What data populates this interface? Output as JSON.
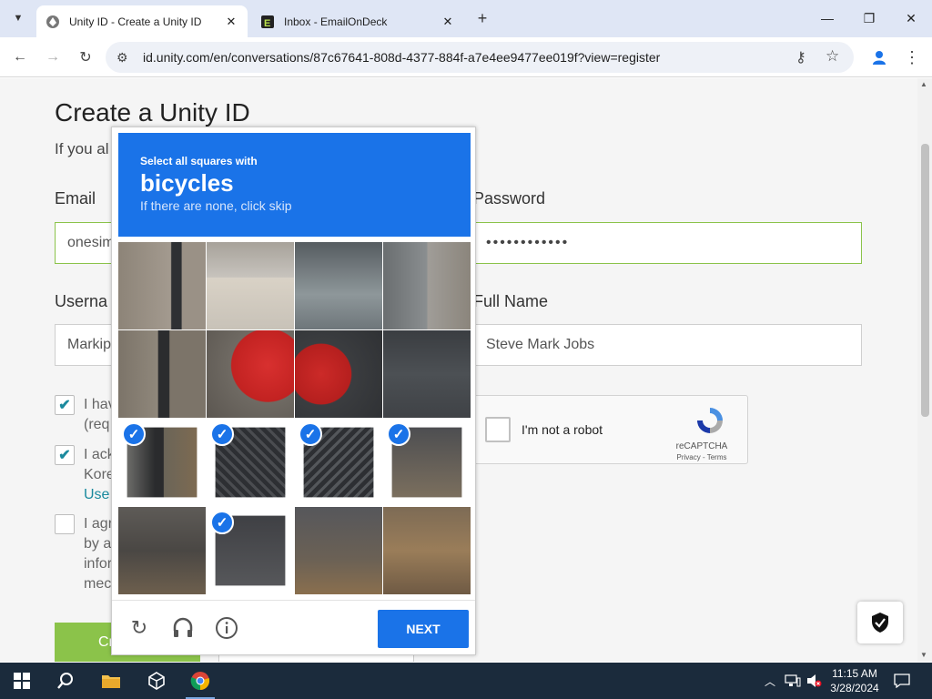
{
  "browser": {
    "tabs": [
      {
        "title": "Unity ID - Create a Unity ID",
        "active": true
      },
      {
        "title": "Inbox - EmailOnDeck",
        "active": false
      }
    ],
    "url": "id.unity.com/en/conversations/87c67641-808d-4377-884f-a7e4ee9477ee019f?view=register"
  },
  "page": {
    "title": "Create a Unity ID",
    "subtitle_partial": "If you al",
    "email": {
      "label": "Email",
      "value": "onesim"
    },
    "password": {
      "label": "Password",
      "value": "••••••••••••"
    },
    "username": {
      "label": "Userna",
      "value": "Markip"
    },
    "fullname": {
      "label": "Full Name",
      "value": "Steve Mark Jobs"
    },
    "terms": [
      {
        "checked": true,
        "lines": [
          "I hav",
          "(req"
        ]
      },
      {
        "checked": true,
        "lines": [
          "I ack",
          "Kore"
        ],
        "link": "Use"
      },
      {
        "checked": false,
        "lines": [
          "I agr",
          "by a",
          "infor",
          "mec"
        ]
      }
    ],
    "create_label": "Create"
  },
  "recaptcha_anchor": {
    "label": "I'm not a robot",
    "brand": "reCAPTCHA",
    "links": "Privacy - Terms"
  },
  "challenge": {
    "line1": "Select all squares with",
    "keyword": "bicycles",
    "line3": "If there are none, click skip",
    "selected_tiles": [
      8,
      9,
      10,
      11,
      13
    ],
    "next_label": "NEXT"
  },
  "taskbar": {
    "time": "11:15 AM",
    "date": "3/28/2024"
  },
  "colors": {
    "accent": "#1a73e8",
    "valid_border": "#8bc34a",
    "taskbar": "#1b2b3c"
  }
}
